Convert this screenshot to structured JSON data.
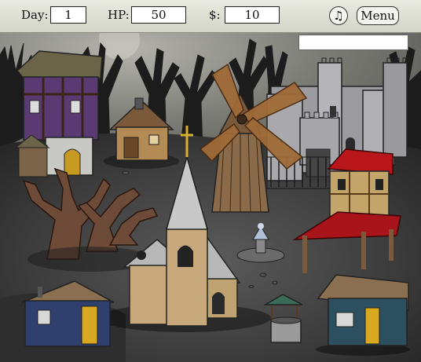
{
  "hud": {
    "day_label": "Day:",
    "day_value": "1",
    "hp_label": "HP:",
    "hp_value": "50",
    "money_label": "$:",
    "money_value": "10",
    "music_icon": "music-note-icon",
    "menu_label": "Menu"
  },
  "message_box": {
    "text": ""
  },
  "colors": {
    "sky": "#6e6e6a",
    "ground": "#3a3a3a",
    "hud_bg": "#dcdfd3",
    "roof_red": "#b8161b",
    "house_blue": "#2f3f6e",
    "church_tan": "#c7a97c"
  }
}
